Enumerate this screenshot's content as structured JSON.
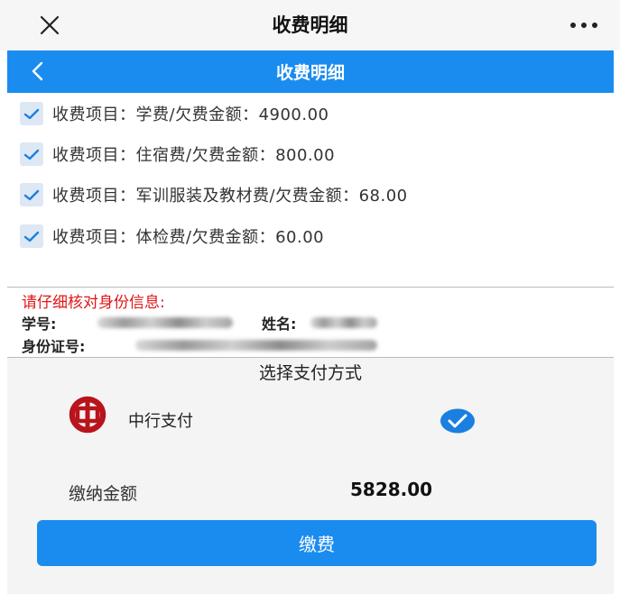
{
  "window": {
    "title": "收费明细",
    "close_icon": "close-icon",
    "more_icon": "more-icon"
  },
  "header": {
    "title": "收费明细",
    "back_icon": "chevron-left-icon",
    "color": "#1a8cf0"
  },
  "fees": [
    {
      "text": "收费项目：学费/欠费金额：4900.00",
      "checked": true
    },
    {
      "text": "收费项目：住宿费/欠费金额：800.00",
      "checked": true
    },
    {
      "text": "收费项目：军训服装及教材费/欠费金额：68.00",
      "checked": true
    },
    {
      "text": "收费项目：体检费/欠费金额：60.00",
      "checked": true
    }
  ],
  "identity": {
    "warning": "请仔细核对身份信息:",
    "warning_color": "#e01818",
    "student_id_label": "学号:",
    "name_label": "姓名:",
    "id_number_label": "身份证号:"
  },
  "payment": {
    "title": "选择支付方式",
    "method_label": "中行支付",
    "method_icon": "bank-of-china-logo",
    "selected": true,
    "amount_label": "缴纳金额",
    "amount_value": "5828.00",
    "pay_button_label": "缴费"
  }
}
